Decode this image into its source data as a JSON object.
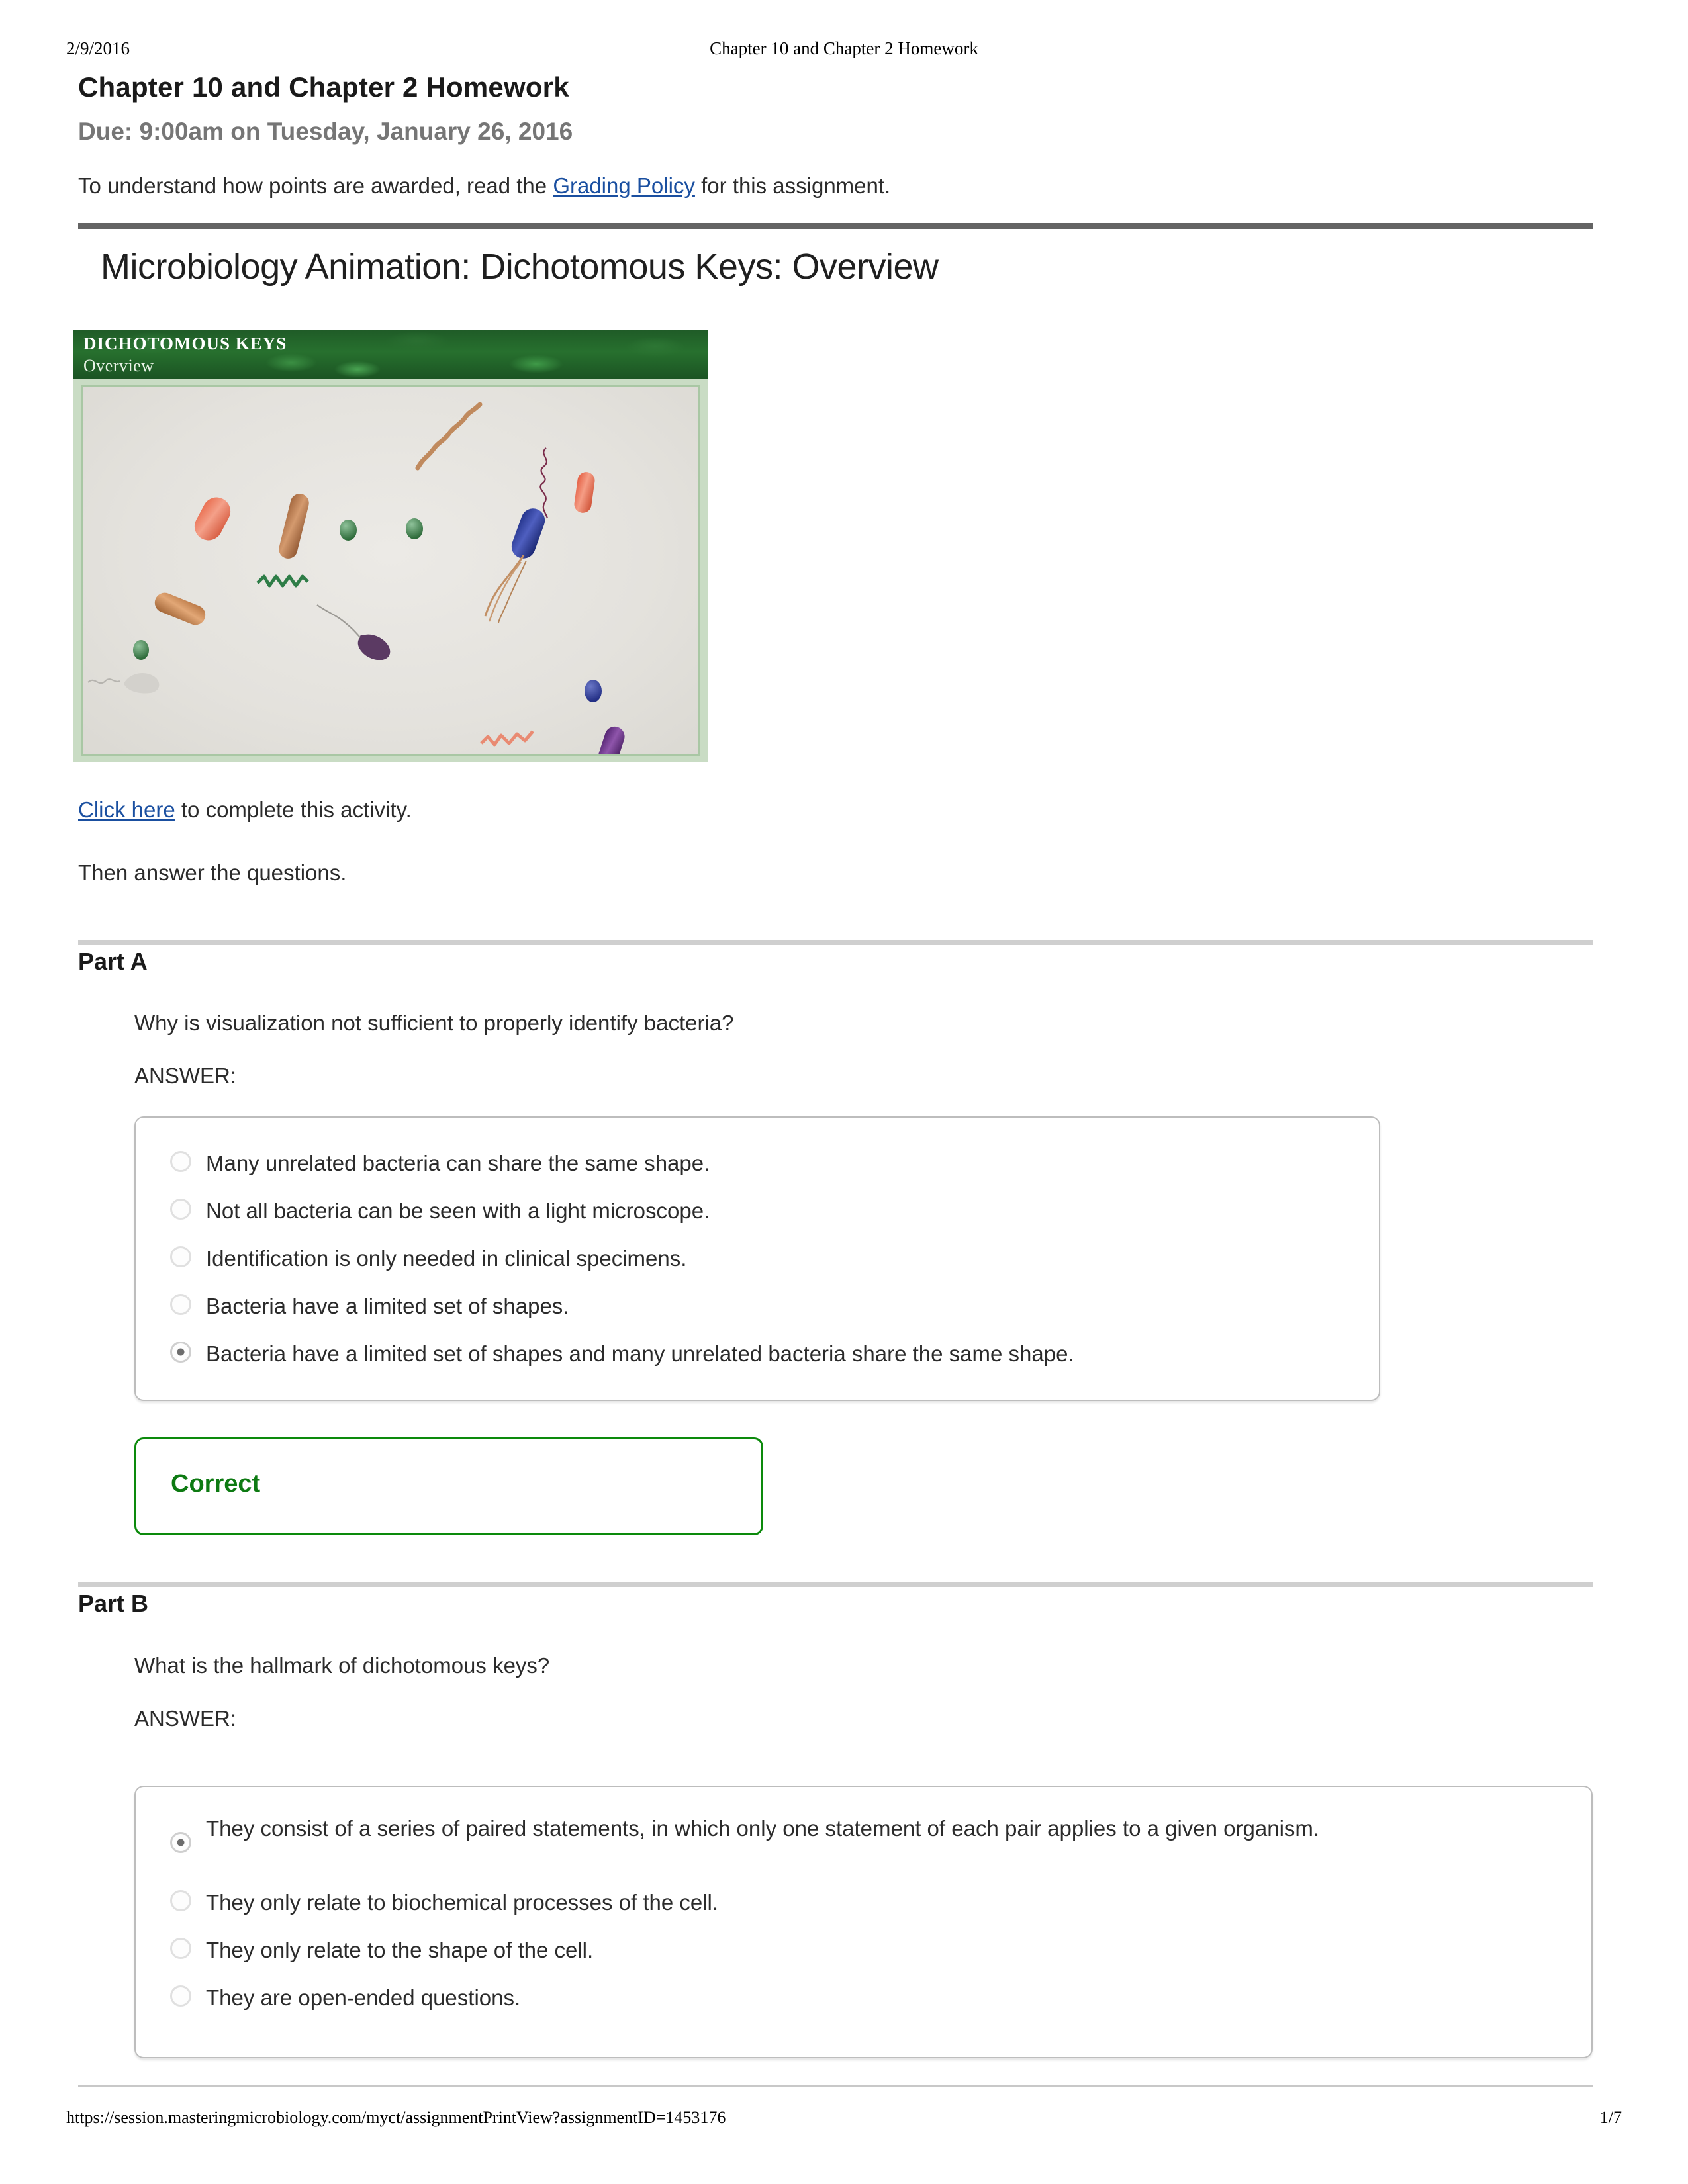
{
  "print_header": {
    "date": "2/9/2016",
    "title": "Chapter 10 and Chapter 2 Homework"
  },
  "document": {
    "title": "Chapter 10 and Chapter 2 Homework",
    "due": "Due: 9:00am on Tuesday, January 26, 2016",
    "grading_prefix": "To understand how points are awarded, read the ",
    "grading_link": "Grading Policy",
    "grading_suffix": " for this assignment."
  },
  "activity": {
    "title": "Microbiology Animation: Dichotomous Keys: Overview",
    "thumbnail": {
      "banner_line1": "DICHOTOMOUS KEYS",
      "banner_line2": "Overview"
    },
    "click_link": "Click here",
    "click_suffix": " to complete this activity.",
    "then_text": "Then answer the questions."
  },
  "parts": [
    {
      "label": "Part A",
      "question": "Why is visualization not sufficient to properly identify bacteria?",
      "answer_label": "ANSWER:",
      "options": [
        {
          "text": "Many unrelated bacteria can share the same shape.",
          "selected": false
        },
        {
          "text": "Not all bacteria can be seen with a light microscope.",
          "selected": false
        },
        {
          "text": "Identification is only needed in clinical specimens.",
          "selected": false
        },
        {
          "text": "Bacteria have a limited set of shapes.",
          "selected": false
        },
        {
          "text": "Bacteria have a limited set of shapes and many unrelated bacteria share the same shape.",
          "selected": true
        }
      ],
      "feedback": "Correct"
    },
    {
      "label": "Part B",
      "question": "What is the hallmark of dichotomous keys?",
      "answer_label": "ANSWER:",
      "options": [
        {
          "text": "They consist of a series of paired statements, in which only one statement of each pair applies to a given organism.",
          "selected": true
        },
        {
          "text": "They only relate to biochemical processes of the cell.",
          "selected": false
        },
        {
          "text": "They only relate to the shape of the cell.",
          "selected": false
        },
        {
          "text": "They are open-ended questions.",
          "selected": false
        }
      ]
    }
  ],
  "footer": {
    "url": "https://session.masteringmicrobiology.com/myct/assignmentPrintView?assignmentID=1453176",
    "page": "1/7"
  },
  "colors": {
    "link": "#1a4fa0",
    "due_text": "#767676",
    "correct": "#0d7a12",
    "rule_dark": "#646464",
    "rule_light": "#cfcfcf"
  }
}
